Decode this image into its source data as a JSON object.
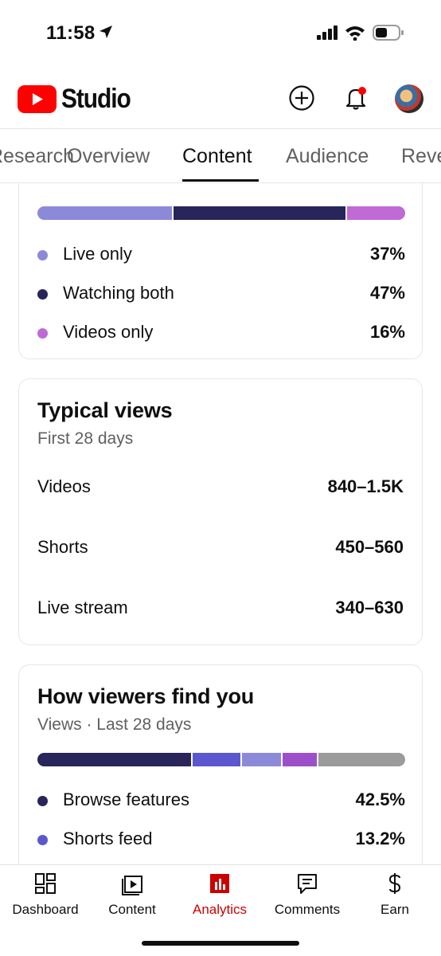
{
  "status_bar": {
    "time": "11:58"
  },
  "header": {
    "brand": "Studio"
  },
  "tabs": [
    {
      "label": "Research"
    },
    {
      "label": "Overview"
    },
    {
      "label": "Content"
    },
    {
      "label": "Audience"
    },
    {
      "label": "Revenue"
    }
  ],
  "viewer_mix": {
    "colors": [
      "#8c8ad8",
      "#27255a",
      "#c06ad6"
    ],
    "items": [
      {
        "label": "Live only",
        "value": "37%",
        "pct": 37
      },
      {
        "label": "Watching both",
        "value": "47%",
        "pct": 47
      },
      {
        "label": "Videos only",
        "value": "16%",
        "pct": 16
      }
    ]
  },
  "typical_views": {
    "title": "Typical views",
    "subtitle": "First 28 days",
    "rows": [
      {
        "label": "Videos",
        "value": "840–1.5K"
      },
      {
        "label": "Shorts",
        "value": "450–560"
      },
      {
        "label": "Live stream",
        "value": "340–630"
      }
    ]
  },
  "find_you": {
    "title": "How viewers find you",
    "subtitle": "Views · Last 28 days",
    "bar": [
      {
        "pct": 42.5,
        "color": "#27255a"
      },
      {
        "pct": 13.2,
        "color": "#5b58cf"
      },
      {
        "pct": 10.8,
        "color": "#8c8ad8"
      },
      {
        "pct": 9.5,
        "color": "#9c4fc9"
      },
      {
        "pct": 24.0,
        "color": "#9b9b9b"
      }
    ],
    "items": [
      {
        "label": "Browse features",
        "value": "42.5%",
        "color": "#27255a"
      },
      {
        "label": "Shorts feed",
        "value": "13.2%",
        "color": "#5b58cf"
      }
    ]
  },
  "bottom_nav": [
    {
      "label": "Dashboard",
      "icon": "dashboard-icon"
    },
    {
      "label": "Content",
      "icon": "content-icon"
    },
    {
      "label": "Analytics",
      "icon": "analytics-icon",
      "active": true
    },
    {
      "label": "Comments",
      "icon": "comments-icon"
    },
    {
      "label": "Earn",
      "icon": "earn-icon"
    }
  ],
  "colors": {
    "brand_red": "#ff0000",
    "active_red": "#cc0000",
    "text": "#0f0f0f",
    "muted": "#606060"
  }
}
